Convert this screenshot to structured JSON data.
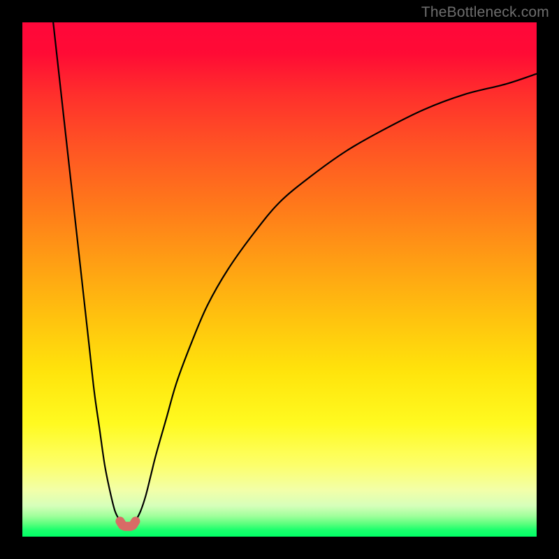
{
  "watermark": "TheBottleneck.com",
  "chart_data": {
    "type": "line",
    "title": "",
    "xlabel": "",
    "ylabel": "",
    "xlim": [
      0,
      100
    ],
    "ylim": [
      0,
      100
    ],
    "grid": false,
    "legend": false,
    "background_gradient": {
      "top_color": "#ff073a",
      "bottom_color": "#00ff66",
      "meaning": "red = high bottleneck, green = low bottleneck"
    },
    "series": [
      {
        "name": "left-branch",
        "stroke": "#000000",
        "x": [
          6,
          7,
          8,
          9,
          10,
          11,
          12,
          13,
          14,
          15,
          16,
          17,
          18,
          19
        ],
        "values": [
          100,
          91,
          82,
          73,
          64,
          55,
          46,
          37,
          28,
          21,
          14,
          9,
          5,
          3
        ]
      },
      {
        "name": "right-branch",
        "stroke": "#000000",
        "x": [
          22,
          23,
          24,
          25,
          26,
          28,
          30,
          33,
          36,
          40,
          45,
          50,
          56,
          63,
          70,
          78,
          86,
          94,
          100
        ],
        "values": [
          3,
          5,
          8,
          12,
          16,
          23,
          30,
          38,
          45,
          52,
          59,
          65,
          70,
          75,
          79,
          83,
          86,
          88,
          90
        ]
      },
      {
        "name": "valley-marker",
        "stroke": "#d86b66",
        "type": "marker",
        "x": [
          19,
          19.5,
          20,
          20.5,
          21,
          21.5,
          22
        ],
        "values": [
          3,
          2.2,
          2,
          2,
          2,
          2.2,
          3
        ]
      }
    ],
    "optimum_x": 20,
    "optimum_y": 2
  }
}
